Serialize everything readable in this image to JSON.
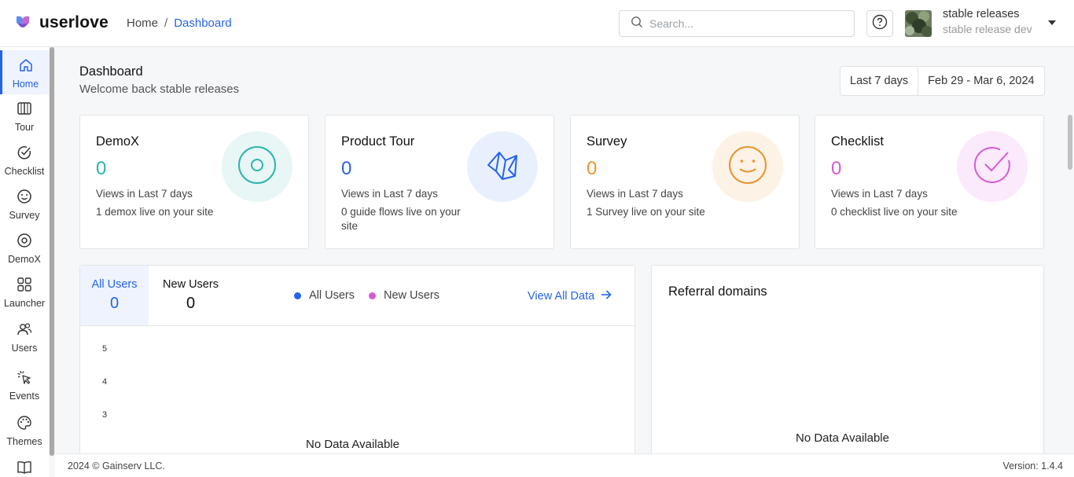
{
  "app": {
    "name": "userlove"
  },
  "breadcrumb": {
    "home": "Home",
    "separator": "/",
    "current": "Dashboard"
  },
  "search": {
    "placeholder": "Search..."
  },
  "user": {
    "name": "stable releases",
    "org": "stable release dev"
  },
  "sidebar": {
    "items": [
      {
        "label": "Home",
        "icon": "home-icon",
        "active": true
      },
      {
        "label": "Tour",
        "icon": "book-icon"
      },
      {
        "label": "Checklist",
        "icon": "check-circle-icon"
      },
      {
        "label": "Survey",
        "icon": "smile-icon"
      },
      {
        "label": "DemoX",
        "icon": "target-icon"
      },
      {
        "label": "Launcher",
        "icon": "grid-icon"
      },
      {
        "label": "Users",
        "icon": "users-icon"
      },
      {
        "label": "Events",
        "icon": "pointer-click-icon"
      },
      {
        "label": "Themes",
        "icon": "palette-icon"
      }
    ]
  },
  "header": {
    "title": "Dashboard",
    "subtitle": "Welcome back stable releases",
    "range_preset": "Last 7 days",
    "range_dates": "Feb 29 - Mar 6, 2024"
  },
  "cards": [
    {
      "title": "DemoX",
      "count": "0",
      "views": "Views in Last 7 days",
      "live": "1 demox live on your site",
      "color": "#2bb5ae",
      "bg": "#e8f6f5",
      "icon": "target-icon"
    },
    {
      "title": "Product Tour",
      "count": "0",
      "views": "Views in Last 7 days",
      "live": "0 guide flows live on your site",
      "color": "#2563eb",
      "bg": "#e9f0fd",
      "icon": "map-icon"
    },
    {
      "title": "Survey",
      "count": "0",
      "views": "Views in Last 7 days",
      "live": "1 Survey live on your site",
      "color": "#e8952f",
      "bg": "#fdf2e6",
      "icon": "smile-icon"
    },
    {
      "title": "Checklist",
      "count": "0",
      "views": "Views in Last 7 days",
      "live": "0 checklist live on your site",
      "color": "#d65ad6",
      "bg": "#fbeafb",
      "icon": "check-circle-icon"
    }
  ],
  "users_chart": {
    "tabs": [
      {
        "label": "All Users",
        "value": "0"
      },
      {
        "label": "New Users",
        "value": "0"
      }
    ],
    "legend": [
      {
        "label": "All Users",
        "color": "#2563eb"
      },
      {
        "label": "New Users",
        "color": "#d65ad6"
      }
    ],
    "view_all": "View All Data",
    "y_ticks": [
      "5",
      "4",
      "3"
    ],
    "empty_text": "No Data Available"
  },
  "referral": {
    "title": "Referral domains",
    "empty_text": "No Data Available"
  },
  "footer": {
    "copyright": "2024 © Gainserv LLC.",
    "version": "Version: 1.4.4"
  }
}
